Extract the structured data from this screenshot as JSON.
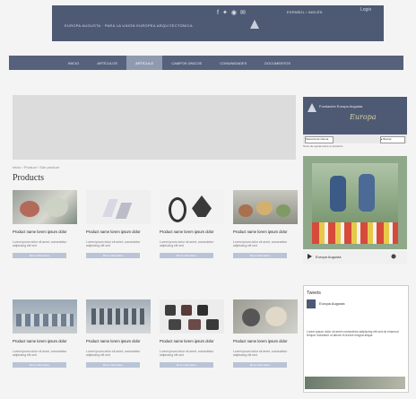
{
  "topbar": {
    "tagline": "EUROPA AUGUSTA · PARA LA UNIÓN EUROPEA ARQUITECTÓNICA",
    "lang": "ESPAÑOL / INGLÉS",
    "login": "Login",
    "icons": [
      "facebook-icon",
      "twitter-icon",
      "rss-icon",
      "mail-icon"
    ]
  },
  "nav": {
    "items": [
      "INICIO",
      "ARTÍCULOS",
      "ARTÍCULO",
      "CAMPOS ÚNICOS",
      "COMUNIDADES",
      "DOCUMENTOS"
    ],
    "active_index": 2
  },
  "breadcrumb": "Inicio › Product › Sub product",
  "page_title": "Products",
  "products": [
    {
      "name": "Product name lorem ipsum dolor",
      "desc": "Lorem ipsum dolor sit amet, consectetur adipiscing elit sed",
      "button": "More information"
    },
    {
      "name": "Product name lorem ipsum dolor",
      "desc": "Lorem ipsum dolor sit amet, consectetur adipiscing elit sed",
      "button": "More information"
    },
    {
      "name": "Product name lorem ipsum dolor",
      "desc": "Lorem ipsum dolor sit amet, consectetur adipiscing elit sed",
      "button": "More information"
    },
    {
      "name": "Product name lorem ipsum dolor",
      "desc": "Lorem ipsum dolor sit amet, consectetur adipiscing elit sed",
      "button": "More information"
    },
    {
      "name": "Product name lorem ipsum dolor",
      "desc": "Lorem ipsum dolor sit amet, consectetur adipiscing elit sed",
      "button": "More information"
    },
    {
      "name": "Product name lorem ipsum dolor",
      "desc": "Lorem ipsum dolor sit amet, consectetur adipiscing elit sed",
      "button": "More information"
    },
    {
      "name": "Product name lorem ipsum dolor",
      "desc": "Lorem ipsum dolor sit amet, consectetur adipiscing elit sed",
      "button": "More information"
    },
    {
      "name": "Product name lorem ipsum dolor",
      "desc": "Lorem ipsum dolor sit amet, consectetur adipiscing elit sed",
      "button": "More information"
    }
  ],
  "sidebar": {
    "header": "Fundación Europa Augusta",
    "script": "Europa",
    "select_label": "Seleccionar idioma",
    "note": "Texto de ayuda sobre el producto",
    "user": "Europa Augusta",
    "card_title": "Tweets",
    "card_sub": "Europa Augusta",
    "card_text": "Lorem ipsum dolor sit amet consectetur adipiscing elit sed do eiusmod tempor incididunt ut labore et dolore magna aliqua."
  },
  "colors": {
    "brand": "#4e5a74",
    "nav_active": "#8f9aae",
    "button": "#b9c4d6"
  }
}
